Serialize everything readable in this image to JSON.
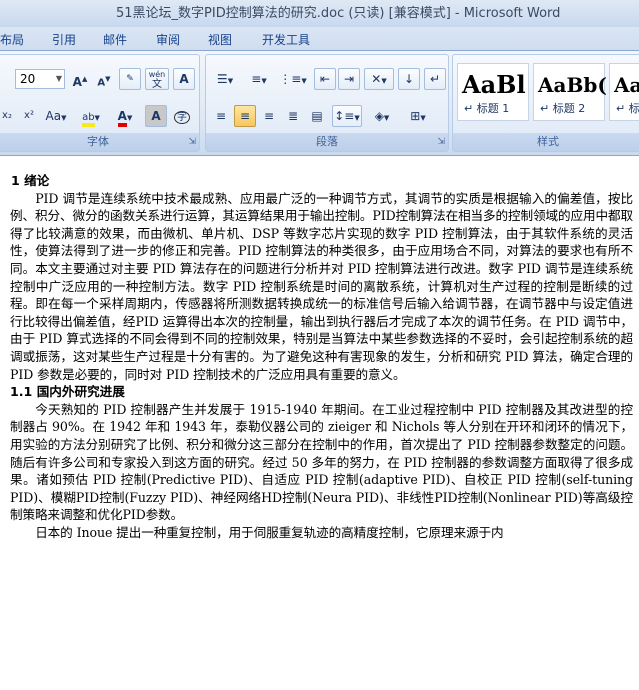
{
  "window": {
    "title": "51黑论坛_数字PID控制算法的研究.doc (只读) [兼容模式] - Microsoft Word"
  },
  "tabs": [
    "布局",
    "引用",
    "邮件",
    "审阅",
    "视图",
    "开发工具"
  ],
  "font_group": {
    "font_size": "20",
    "label": "字体",
    "grow": "A",
    "shrink": "A",
    "phonetic": "wén",
    "char_border": "A",
    "subscript": "x₂",
    "superscript": "x²",
    "change_case": "Aa",
    "highlight": "ab",
    "font_color": "A",
    "char_shading": "A",
    "enclose": "字"
  },
  "paragraph_group": {
    "label": "段落"
  },
  "styles_group": {
    "label": "样式",
    "tiles": [
      {
        "preview": "AaBl",
        "name": "↵ 标题 1"
      },
      {
        "preview": "AaBb(",
        "name": "↵ 标题 2"
      },
      {
        "preview": "AaI",
        "name": "↵ 标"
      }
    ]
  },
  "document": {
    "h1": "1 绪论",
    "p1": "PID 调节是连续系统中技术最成熟、应用最广泛的一种调节方式，其调节的实质是根据输入的偏差值，按比例、积分、微分的函数关系进行运算，其运算结果用于输出控制。PID控制算法在相当多的控制领域的应用中都取得了比较满意的效果，而由微机、单片机、DSP 等数字芯片实现的数字 PID 控制算法，由于其软件系统的灵活性，使算法得到了进一步的修正和完善。PID 控制算法的种类很多，由于应用场合不同，对算法的要求也有所不同。本文主要通过对主要 PID 算法存在的问题进行分析并对 PID 控制算法进行改进。数字 PID 调节是连续系统控制中广泛应用的一种控制方法。数字 PID 控制系统是时间的离散系统，计算机对生产过程的控制是断续的过程。即在每一个采样周期内，传感器将所测数据转换成统一的标准信号后输入给调节器，在调节器中与设定值进行比较得出偏差值，经PID 运算得出本次的控制量，输出到执行器后才完成了本次的调节任务。在 PID 调节中，由于 PID 算式选择的不同会得到不同的控制效果，特别是当算法中某些参数选择的不妥时，会引起控制系统的超调或振荡，这对某些生产过程是十分有害的。为了避免这种有害现象的发生，分析和研究 PID 算法，确定合理的 PID 参数是必要的，同时对 PID 控制技术的广泛应用具有重要的意义。",
    "h2": "1.1 国内外研究进展",
    "p2": "今天熟知的 PID 控制器产生并发展于 1915-1940 年期间。在工业过程控制中 PID 控制器及其改进型的控制器占 90%。在 1942 年和 1943 年，泰勒仪器公司的 zieiger 和 Nichols 等人分别在开环和闭环的情况下，用实验的方法分别研究了比例、积分和微分这三部分在控制中的作用，首次提出了 PID 控制器参数整定的问题。随后有许多公司和专家投入到这方面的研究。经过 50 多年的努力，在 PID 控制器的参数调整方面取得了很多成果。诸如预估 PID 控制(Predictive PID)、自适应 PID 控制(adaptive PID)、自校正 PID 控制(self-tuning PID)、模糊PID控制(Fuzzy PID)、神经网络HD控制(Neura PID)、非线性PID控制(Nonlinear PID)等高级控制策略来调整和优化PID参数。",
    "p3": "日本的 Inoue 提出一种重复控制，用于伺服重复轨迹的高精度控制，它原理来源于内"
  }
}
